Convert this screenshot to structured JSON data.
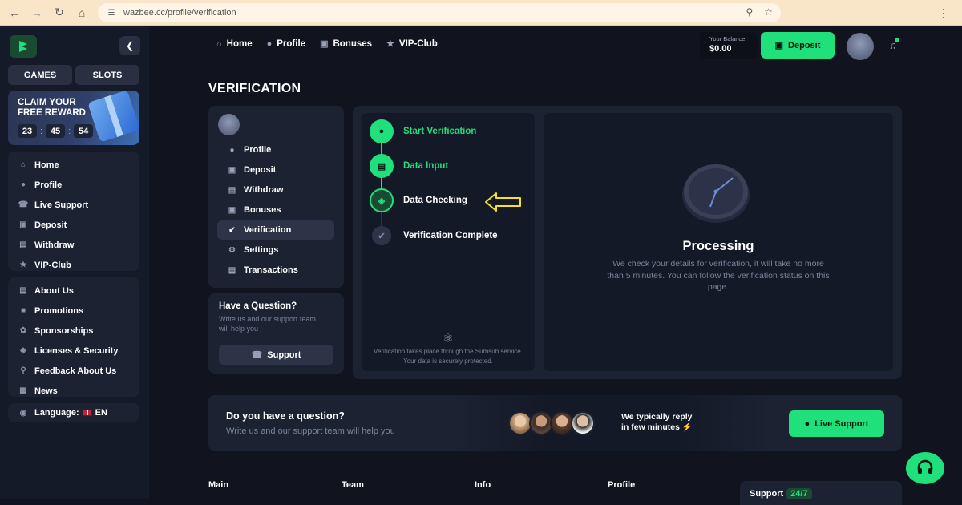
{
  "browser": {
    "url": "wazbee.cc/profile/verification"
  },
  "sidebar": {
    "games_label": "GAMES",
    "slots_label": "SLOTS",
    "promo": {
      "title": "CLAIM YOUR FREE REWARD",
      "hours": "23",
      "minutes": "45",
      "seconds": "54"
    },
    "nav1": [
      {
        "label": "Home",
        "icon": "home-icon"
      },
      {
        "label": "Profile",
        "icon": "user-icon"
      },
      {
        "label": "Live Support",
        "icon": "headset-icon"
      },
      {
        "label": "Deposit",
        "icon": "wallet-icon"
      },
      {
        "label": "Withdraw",
        "icon": "withdraw-icon"
      },
      {
        "label": "VIP-Club",
        "icon": "star-icon"
      }
    ],
    "nav2": [
      {
        "label": "About Us",
        "icon": "book-icon"
      },
      {
        "label": "Promotions",
        "icon": "promo-icon"
      },
      {
        "label": "Sponsorships",
        "icon": "badge-icon"
      },
      {
        "label": "Licenses & Security",
        "icon": "shield-icon"
      },
      {
        "label": "Feedback About Us",
        "icon": "feedback-icon"
      },
      {
        "label": "News",
        "icon": "news-icon"
      }
    ],
    "language_label": "Language:",
    "language_value": "EN"
  },
  "header": {
    "nav": [
      "Home",
      "Profile",
      "Bonuses",
      "VIP-Club"
    ],
    "balance_label": "Your Balance",
    "balance_value": "$0.00",
    "deposit_label": "Deposit"
  },
  "page": {
    "title": "VERIFICATION",
    "profile_menu": [
      "Profile",
      "Deposit",
      "Withdraw",
      "Bonuses",
      "Verification",
      "Settings",
      "Transactions"
    ],
    "active_menu": "Verification",
    "question": {
      "title": "Have a Question?",
      "text": "Write us and our support team will help you",
      "button": "Support"
    },
    "steps": [
      {
        "label": "Start Verification",
        "state": "done"
      },
      {
        "label": "Data Input",
        "state": "done"
      },
      {
        "label": "Data Checking",
        "state": "current"
      },
      {
        "label": "Verification Complete",
        "state": "pending"
      }
    ],
    "sumsub_note": "Verification takes place through the Sumsub service. Your data is securely protected.",
    "processing_title": "Processing",
    "processing_text": "We check your details for verification, it will take no more than 5 minutes. You can follow the verification status on this page."
  },
  "banner": {
    "title": "Do you have a question?",
    "text": "Write us and our support team will help you",
    "reply_line1": "We typically reply",
    "reply_line2": "in few minutes",
    "button": "Live Support"
  },
  "footer": {
    "columns": [
      "Main",
      "Team",
      "Info",
      "Profile"
    ],
    "support_label": "Support",
    "support_badge": "24/7"
  },
  "colors": {
    "accent": "#1fe07a",
    "background": "#11141f",
    "panel": "#1d2233",
    "annotation_arrow": "#f5e11e"
  }
}
